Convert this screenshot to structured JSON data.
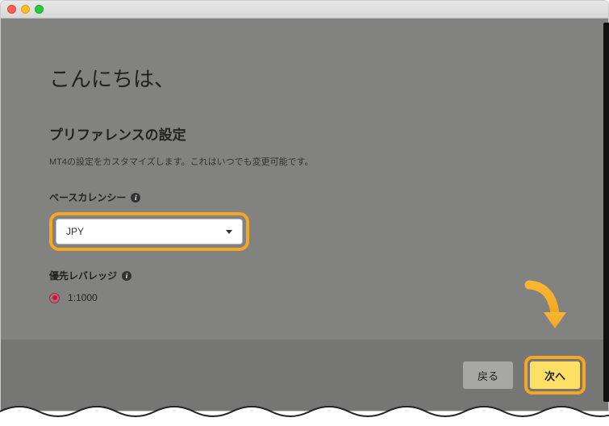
{
  "greeting": "こんにちは、",
  "section": {
    "title": "プリファレンスの設定",
    "description": "MT4の設定をカスタマイズします。これはいつでも変更可能です。"
  },
  "baseCurrency": {
    "label": "ベースカレンシー",
    "selected": "JPY"
  },
  "leverage": {
    "label": "優先レバレッジ",
    "options": [
      {
        "value": "1:1000",
        "selected": true
      }
    ]
  },
  "buttons": {
    "back": "戻る",
    "next": "次へ"
  },
  "colors": {
    "highlight": "#f5a623",
    "nextButton": "#ffe066",
    "radio": "#e03"
  }
}
